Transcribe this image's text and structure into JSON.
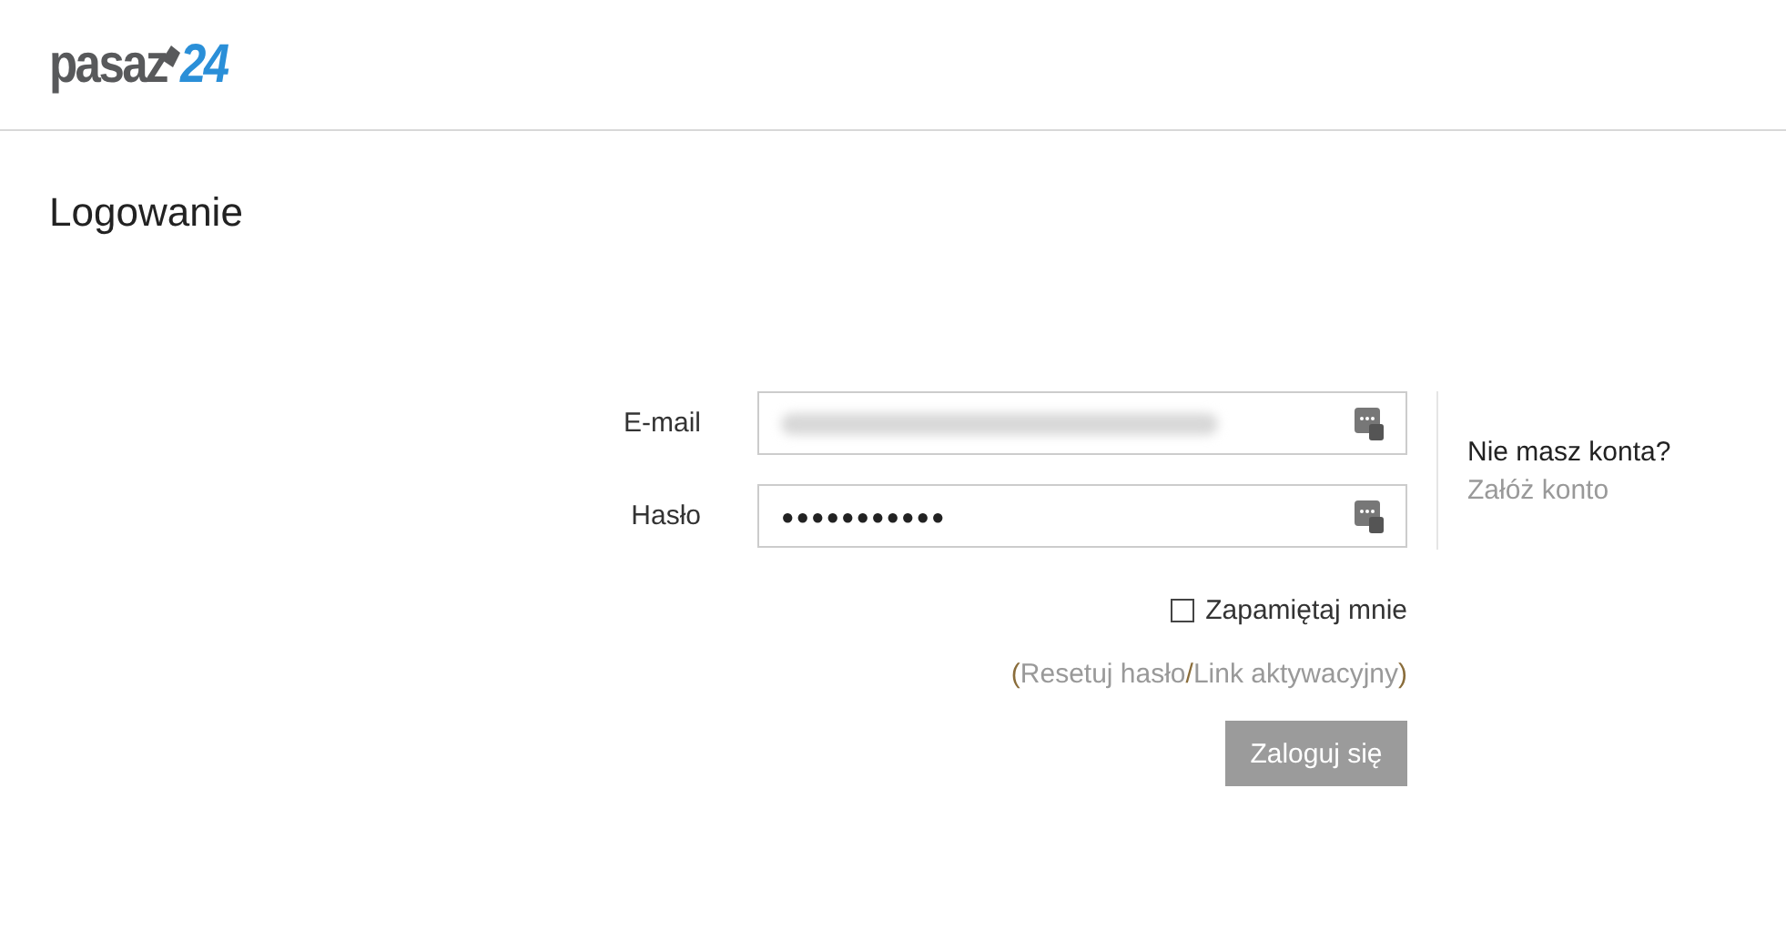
{
  "header": {
    "logo": {
      "text": "pasaz",
      "accent": "24"
    }
  },
  "page_title": "Logowanie",
  "form": {
    "fields": [
      {
        "label": "E-mail",
        "kind": "email"
      },
      {
        "label": "Hasło",
        "kind": "password",
        "value": "●●●●●●●●●●●"
      }
    ],
    "remember": {
      "label": "Zapamiętaj mnie",
      "checked": false
    },
    "links": {
      "open": "(",
      "reset": "Resetuj hasło",
      "separator": "/",
      "activation": "Link aktywacyjny",
      "close": ")"
    },
    "submit": "Zaloguj się"
  },
  "signup": {
    "question": "Nie masz konta?",
    "link": "Załóż konto"
  }
}
